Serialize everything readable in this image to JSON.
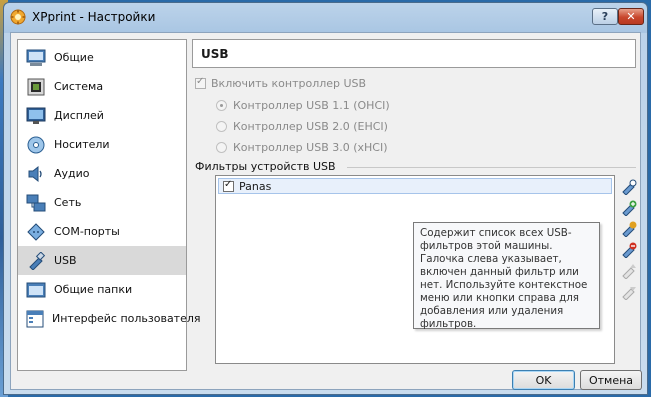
{
  "window": {
    "title": "XPprint - Настройки",
    "help_label": "?",
    "close_label": "✕"
  },
  "sidebar": {
    "items": [
      {
        "label": "Общие",
        "icon": "general-icon"
      },
      {
        "label": "Система",
        "icon": "system-icon"
      },
      {
        "label": "Дисплей",
        "icon": "display-icon"
      },
      {
        "label": "Носители",
        "icon": "storage-icon"
      },
      {
        "label": "Аудио",
        "icon": "audio-icon"
      },
      {
        "label": "Сеть",
        "icon": "network-icon"
      },
      {
        "label": "COM-порты",
        "icon": "serial-ports-icon"
      },
      {
        "label": "USB",
        "icon": "usb-icon",
        "selected": true
      },
      {
        "label": "Общие папки",
        "icon": "shared-folders-icon"
      },
      {
        "label": "Интерфейс пользователя",
        "icon": "user-interface-icon"
      }
    ]
  },
  "usb": {
    "header": "USB",
    "enable_label": "Включить контроллер USB",
    "enable_checked": true,
    "controllers": [
      {
        "label": "Контроллер USB 1.1 (OHCI)",
        "selected": true
      },
      {
        "label": "Контроллер USB 2.0 (EHCI)",
        "selected": false
      },
      {
        "label": "Контроллер USB 3.0 (xHCI)",
        "selected": false
      }
    ],
    "filters_group_label": "Фильтры устройств USB",
    "filters": [
      {
        "name": "Panas",
        "checked": true
      }
    ],
    "tools": [
      "add-empty-filter-icon",
      "add-device-filter-icon",
      "edit-filter-icon",
      "remove-filter-icon",
      "move-up-icon",
      "move-down-icon"
    ],
    "tooltip": "Содержит список всех USB-фильтров этой машины. Галочка слева указывает, включен данный фильтр или нет. Используйте контекстное меню или кнопки справа для добавления или удаления фильтров."
  },
  "buttons": {
    "ok": "OK",
    "cancel": "Отмена"
  }
}
